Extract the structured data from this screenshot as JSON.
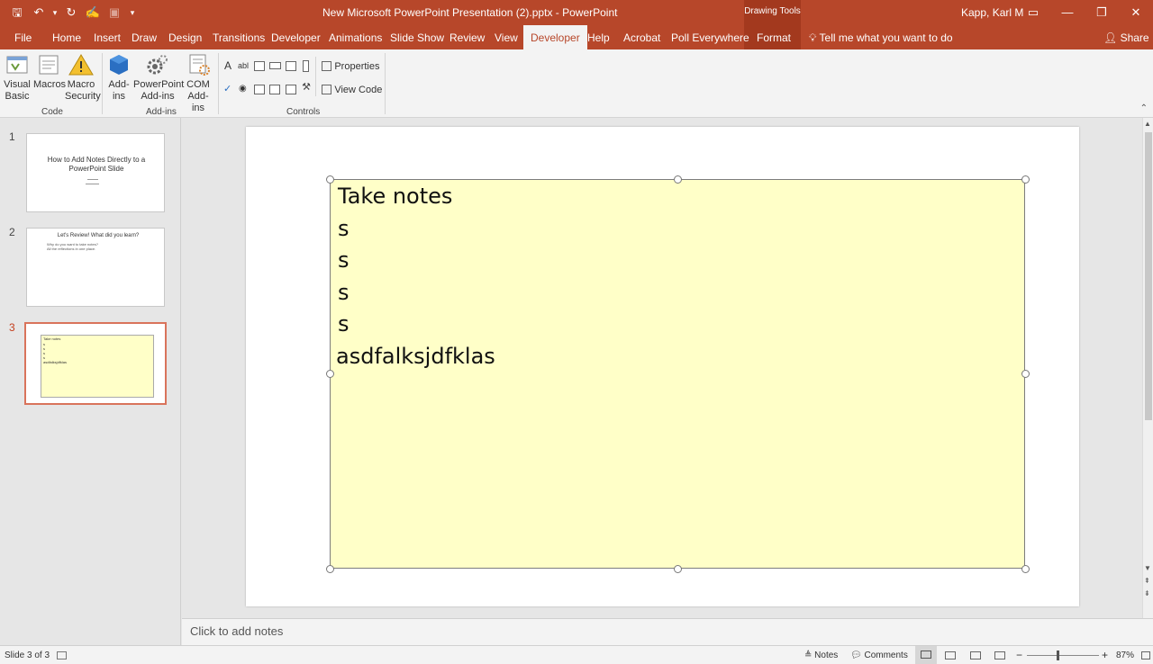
{
  "titlebar": {
    "title": "New Microsoft PowerPoint Presentation (2).pptx  -  PowerPoint",
    "context_tab_group": "Drawing Tools",
    "user": "Kapp, Karl M",
    "qat": {
      "save": "🖫",
      "undo": "↶",
      "undo_arrow": "▾",
      "redo": "↻",
      "touch": "✍",
      "present": "▣",
      "customize": "▾"
    },
    "window": {
      "ribbon_options": "▭",
      "minimize": "—",
      "restore": "❐",
      "close": "✕"
    }
  },
  "tabs": [
    {
      "label": "File"
    },
    {
      "label": "Home"
    },
    {
      "label": "Insert"
    },
    {
      "label": "Draw"
    },
    {
      "label": "Design"
    },
    {
      "label": "Transitions"
    },
    {
      "label": "Developer"
    },
    {
      "label": "Animations"
    },
    {
      "label": "Slide Show"
    },
    {
      "label": "Review"
    },
    {
      "label": "View"
    },
    {
      "label": "Developer"
    },
    {
      "label": "Help"
    },
    {
      "label": "Acrobat"
    },
    {
      "label": "Poll Everywhere"
    },
    {
      "label": "Format"
    }
  ],
  "tell_me": "Tell me what you want to do",
  "share": "Share",
  "ribbon": {
    "code": {
      "label": "Code",
      "visual_basic": "Visual\nBasic",
      "macros": "Macros",
      "macro_security": "Macro\nSecurity"
    },
    "addins": {
      "label": "Add-ins",
      "addins": "Add-\nins",
      "powerpoint_addins": "PowerPoint\nAdd-ins",
      "com_addins": "COM\nAdd-ins"
    },
    "controls": {
      "label": "Controls",
      "label_control_glyph": "A",
      "textbox_glyph": "abl",
      "checkbox_glyph": "✓",
      "option_glyph": "◉",
      "properties": "Properties",
      "view_code": "View Code"
    },
    "collapse": "⌃"
  },
  "slides": [
    {
      "number": "1",
      "title": "How to Add Notes Directly to a PowerPoint Slide",
      "sub": "",
      "active": false
    },
    {
      "number": "2",
      "title": "Let's Review! What did you learn?",
      "body1": "Why do you want to take notes?",
      "body2": "All the reflections in one place.",
      "active": false
    },
    {
      "number": "3",
      "title": "",
      "active": true
    }
  ],
  "note_box": {
    "lines": [
      "Take notes",
      "s",
      "s",
      "s",
      "s",
      "asdfalksjdfklas"
    ],
    "fill_color": "#ffffc8"
  },
  "notes_placeholder": "Click to add notes",
  "statusbar": {
    "slide_indicator": "Slide 3 of 3",
    "notes": "Notes",
    "comments": "Comments",
    "zoom_minus": "−",
    "zoom_plus": "+",
    "zoom": "87%"
  },
  "colors": {
    "accent": "#b7472a",
    "context_tab": "#a3391e",
    "active_thumb_border": "#d9735b"
  }
}
